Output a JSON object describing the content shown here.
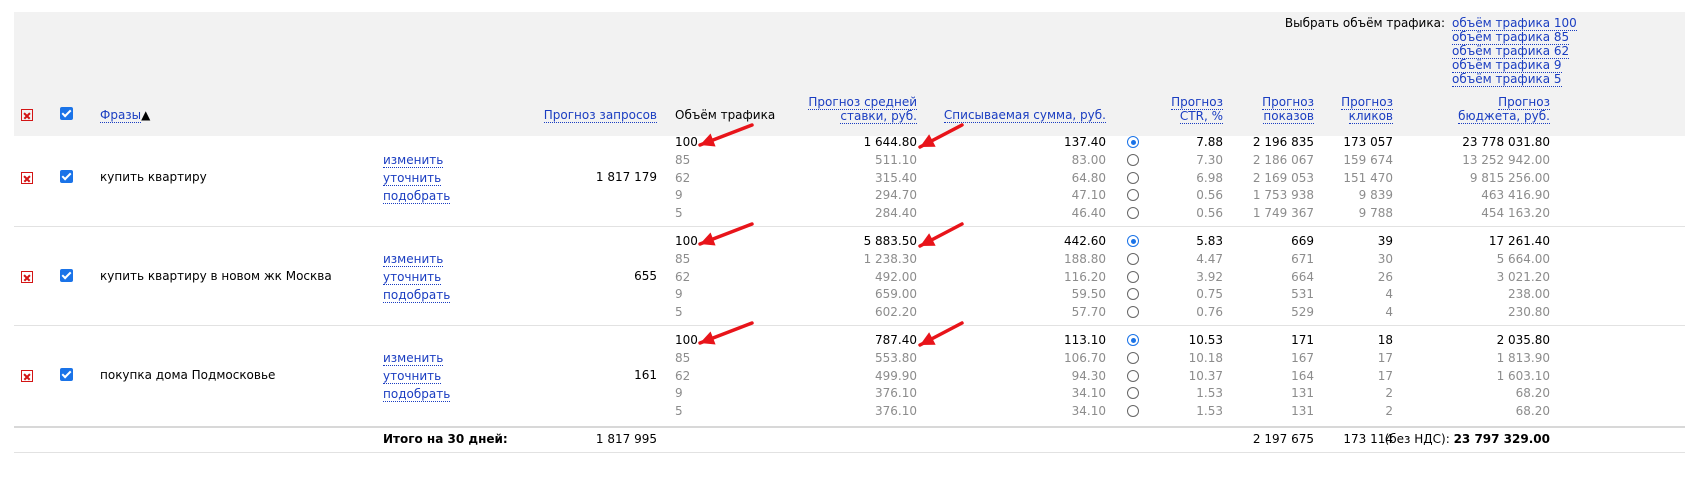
{
  "header": {
    "select_volume_label": "Выбрать объём трафика:",
    "volume_links": [
      "объём трафика 100",
      "объём трафика 85",
      "объём трафика 62",
      "объём трафика 9",
      "объём трафика 5"
    ],
    "col_phrases": "Фразы",
    "sort_indicator": "▲",
    "col_queries": "Прогноз запросов",
    "col_volume": "Объём трафика",
    "col_bid_line1": "Прогноз средней",
    "col_bid_line2": "ставки, руб.",
    "col_charge": "Списываемая сумма, руб.",
    "col_ctr_line1": "Прогноз",
    "col_ctr_line2": "CTR, %",
    "col_impr_line1": "Прогноз",
    "col_impr_line2": "показов",
    "col_clicks_line1": "Прогноз",
    "col_clicks_line2": "кликов",
    "col_budget_line1": "Прогноз",
    "col_budget_line2": "бюджета, руб."
  },
  "row_actions": [
    "изменить",
    "уточнить",
    "подобрать"
  ],
  "rows": [
    {
      "phrase": "купить квартиру",
      "queries": "1 817 179",
      "volume": [
        "100",
        "85",
        "62",
        "9",
        "5"
      ],
      "bid": [
        "1 644.80",
        "511.10",
        "315.40",
        "294.70",
        "284.40"
      ],
      "charge": [
        "137.40",
        "83.00",
        "64.80",
        "47.10",
        "46.40"
      ],
      "ctr": [
        "7.88",
        "7.30",
        "6.98",
        "0.56",
        "0.56"
      ],
      "impressions": [
        "2 196 835",
        "2 186 067",
        "2 169 053",
        "1 753 938",
        "1 749 367"
      ],
      "clicks": [
        "173 057",
        "159 674",
        "151 470",
        "9 839",
        "9 788"
      ],
      "budget": [
        "23 778 031.80",
        "13 252 942.00",
        "9 815 256.00",
        "463 416.90",
        "454 163.20"
      ],
      "selected_index": 0
    },
    {
      "phrase": "купить квартиру в новом жк Москва",
      "queries": "655",
      "volume": [
        "100",
        "85",
        "62",
        "9",
        "5"
      ],
      "bid": [
        "5 883.50",
        "1 238.30",
        "492.00",
        "659.00",
        "602.20"
      ],
      "charge": [
        "442.60",
        "188.80",
        "116.20",
        "59.50",
        "57.70"
      ],
      "ctr": [
        "5.83",
        "4.47",
        "3.92",
        "0.75",
        "0.76"
      ],
      "impressions": [
        "669",
        "671",
        "664",
        "531",
        "529"
      ],
      "clicks": [
        "39",
        "30",
        "26",
        "4",
        "4"
      ],
      "budget": [
        "17 261.40",
        "5 664.00",
        "3 021.20",
        "238.00",
        "230.80"
      ],
      "selected_index": 0
    },
    {
      "phrase": "покупка дома Подмосковье",
      "queries": "161",
      "volume": [
        "100",
        "85",
        "62",
        "9",
        "5"
      ],
      "bid": [
        "787.40",
        "553.80",
        "499.90",
        "376.10",
        "376.10"
      ],
      "charge": [
        "113.10",
        "106.70",
        "94.30",
        "34.10",
        "34.10"
      ],
      "ctr": [
        "10.53",
        "10.18",
        "10.37",
        "1.53",
        "1.53"
      ],
      "impressions": [
        "171",
        "167",
        "164",
        "131",
        "131"
      ],
      "clicks": [
        "18",
        "17",
        "17",
        "2",
        "2"
      ],
      "budget": [
        "2 035.80",
        "1 813.90",
        "1 603.10",
        "68.20",
        "68.20"
      ],
      "selected_index": 0
    }
  ],
  "totals": {
    "label": "Итого на 30 дней:",
    "queries": "1 817 995",
    "impressions": "2 197 675",
    "clicks": "173 114",
    "budget_prefix": "(без НДС):",
    "budget": "23 797 329.00"
  },
  "colors": {
    "link": "#1a3dc1",
    "accent": "#1a73e8",
    "delete": "#d31515",
    "arrow": "#e8141a",
    "header_bg": "#f2f2f2"
  }
}
